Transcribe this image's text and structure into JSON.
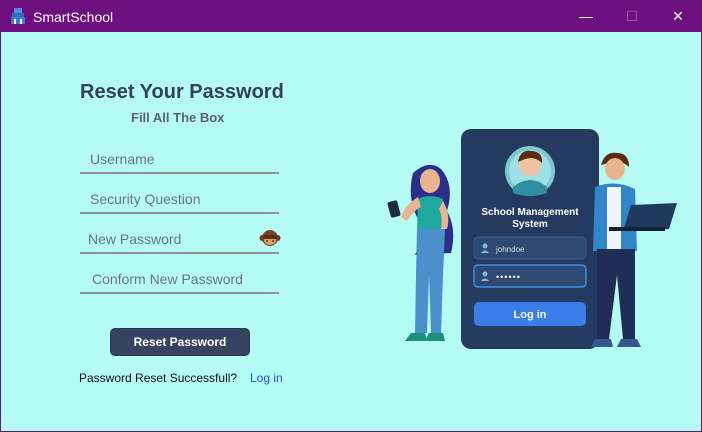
{
  "window": {
    "title": "SmartSchool",
    "controls": {
      "minimize": "—",
      "maximize": "☐",
      "close": "✕"
    }
  },
  "form": {
    "title": "Reset Your Password",
    "subtitle": "Fill All The Box",
    "fields": {
      "username": {
        "placeholder": "Username",
        "value": ""
      },
      "security_question": {
        "placeholder": "Security Question",
        "value": ""
      },
      "new_password": {
        "placeholder": "New Password",
        "value": ""
      },
      "confirm_password": {
        "placeholder": "Conform New Password",
        "value": ""
      }
    },
    "reset_button": "Reset Password",
    "status_message": "Password Reset Successfull?",
    "login_link": "Log in"
  },
  "illustration": {
    "card_title_line1": "School Management",
    "card_title_line2": "System",
    "username_value": "johndoe",
    "password_value": "••••••",
    "login_button": "Log in"
  }
}
